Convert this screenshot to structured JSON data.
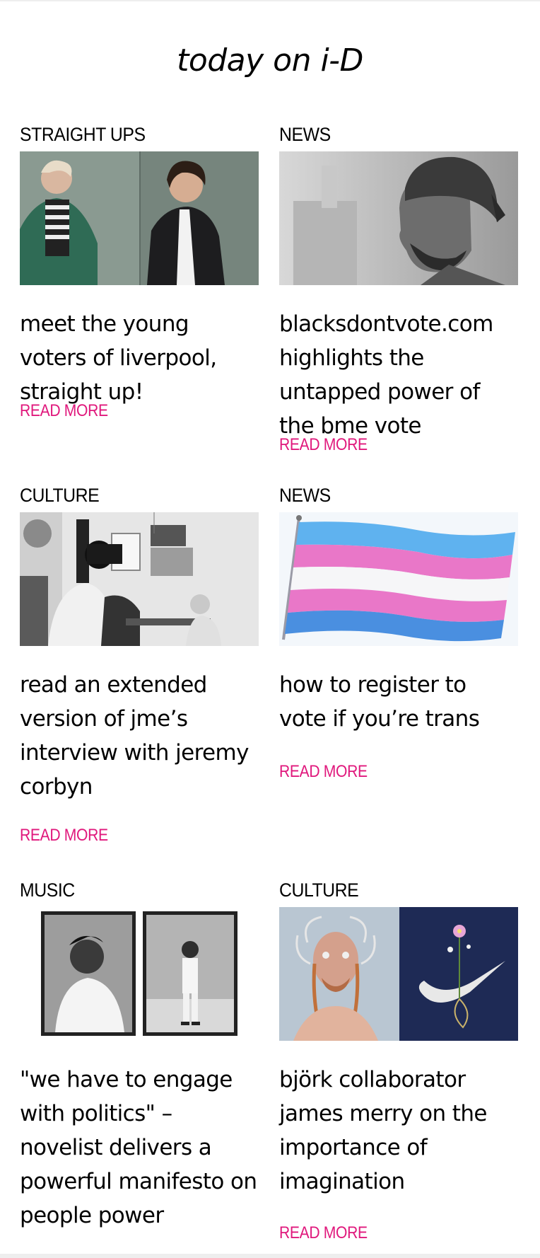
{
  "heading": "today on i-D",
  "read_more_label": "READ MORE",
  "accent_color": "#e0187c",
  "articles": [
    {
      "category": "STRAIGHT UPS",
      "title": "meet the young voters of liverpool, straight up!",
      "image": "two-young-people-portrait"
    },
    {
      "category": "NEWS",
      "title": "blacksdontvote.com highlights the untapped power of the bme vote",
      "image": "man-in-cap-profile-bw"
    },
    {
      "category": "CULTURE",
      "title": "read an extended version of jme’s interview with jeremy corbyn",
      "image": "film-crew-in-cafe-bw"
    },
    {
      "category": "NEWS",
      "title": "how to register to vote if you’re trans",
      "image": "trans-pride-flag"
    },
    {
      "category": "MUSIC",
      "title": "\"we have to engage with politics\" – novelist delivers a powerful manifesto on people power",
      "image": "two-framed-portraits-bw"
    },
    {
      "category": "CULTURE",
      "title": "björk collaborator james merry on the importance of imagination",
      "image": "embroidered-mask-and-nike-swoosh"
    }
  ]
}
